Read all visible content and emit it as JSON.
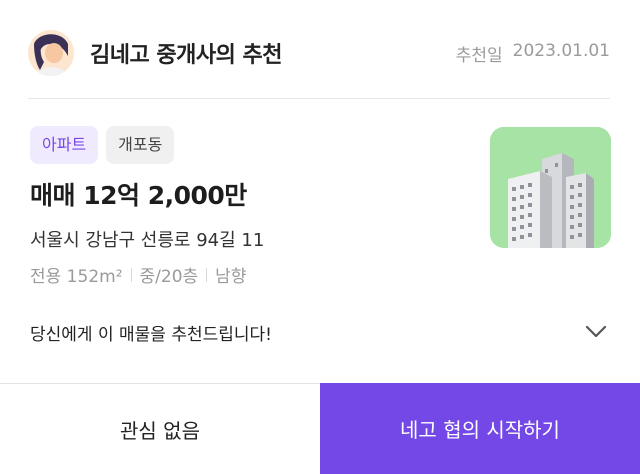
{
  "header": {
    "agent_title": "김네고 중개사의 추천",
    "date_label": "추천일",
    "date_value": "2023.01.01"
  },
  "listing": {
    "tags": [
      "아파트",
      "개포동"
    ],
    "price": "매매 12억 2,000만",
    "address": "서울시 강남구 선릉로 94길 11",
    "area": "전용 152m²",
    "floor": "중/20층",
    "direction": "남향"
  },
  "recommendation_message": "당신에게 이 매물을 추천드립니다!",
  "buttons": {
    "not_interested": "관심 없음",
    "start_negotiation": "네고 협의 시작하기"
  },
  "icons": [
    "avatar",
    "building-icon",
    "chevron-down-icon"
  ],
  "colors": {
    "accent": "#7348e6",
    "tag_primary_bg": "#efeafd",
    "tag_primary_text": "#7a49e6",
    "thumbnail_bg": "#a6e3a5"
  }
}
